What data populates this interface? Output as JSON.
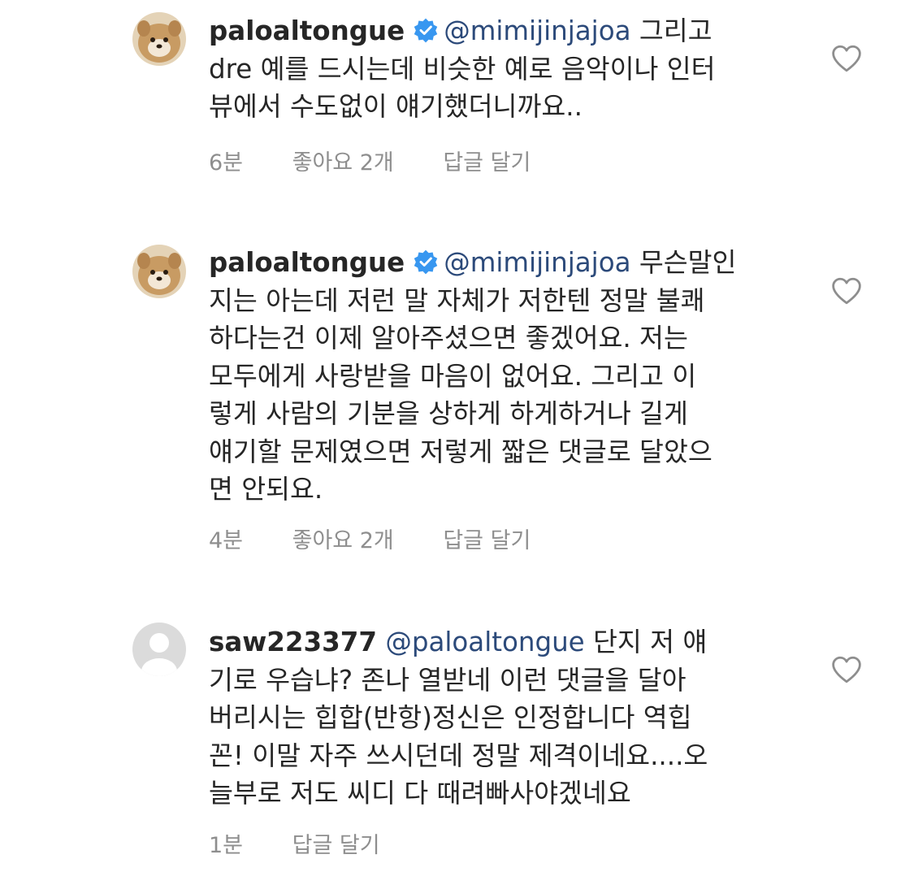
{
  "comments": [
    {
      "username": "paloaltongue",
      "verified": true,
      "mention": "@mimijinjajoa",
      "lines": [
        "그리고",
        "dre 예를 드시는데 비슷한 예로 음악이나 인터",
        "뷰에서 수도없이 얘기했더니까요.."
      ],
      "time": "6분",
      "likes_label": "좋아요 2개",
      "reply_label": "답글 달기",
      "avatar_icon": "dog-avatar",
      "like_icon": "heart-outline-icon"
    },
    {
      "username": "paloaltongue",
      "verified": true,
      "mention": "@mimijinjajoa",
      "lines": [
        "무슨말인",
        "지는 아는데 저런 말 자체가 저한텐 정말 불쾌",
        "하다는건 이제 알아주셨으면 좋겠어요. 저는",
        "모두에게 사랑받을 마음이 없어요. 그리고 이",
        "렇게 사람의 기분을 상하게 하게하거나 길게",
        "얘기할 문제였으면 저렇게 짧은 댓글로 달았으",
        "면 안되요."
      ],
      "time": "4분",
      "likes_label": "좋아요 2개",
      "reply_label": "답글 달기",
      "avatar_icon": "dog-avatar",
      "like_icon": "heart-outline-icon"
    },
    {
      "username": "saw223377",
      "verified": false,
      "mention": "@paloaltongue",
      "lines": [
        "단지 저 얘",
        "기로  우습냐? 존나 열받네 이런 댓글을 달아",
        "버리시는 힙합(반항)정신은 인정합니다 역힙",
        "꼰! 이말 자주 쓰시던데 정말 제격이네요....오",
        "늘부로 저도 씨디 다 때려빠사야겠네요"
      ],
      "time": "1분",
      "reply_label": "답글 달기",
      "avatar_icon": "default-user-avatar",
      "like_icon": "heart-outline-icon"
    }
  ],
  "colors": {
    "text": "#262626",
    "mention": "#2c4a7a",
    "meta": "#8e8e8e",
    "verified": "#3897f0",
    "placeholder_avatar": "#dbdbdb"
  }
}
